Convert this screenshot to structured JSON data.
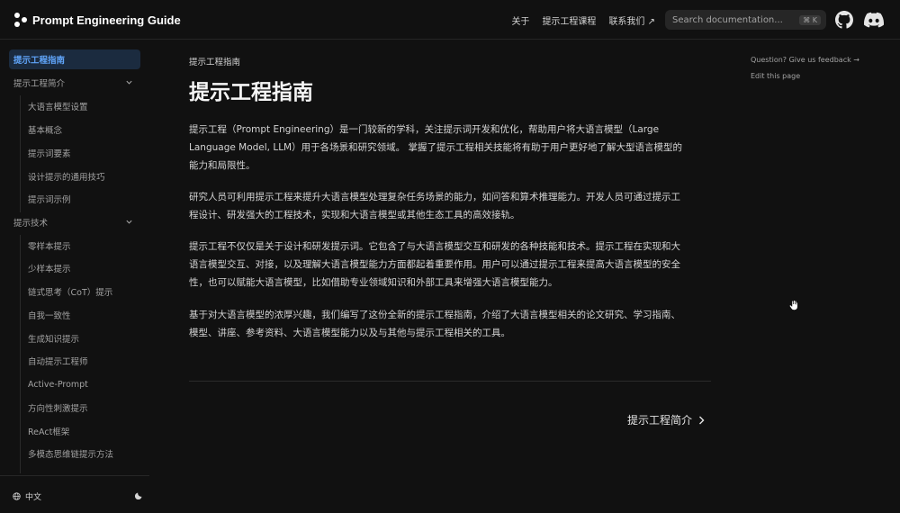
{
  "header": {
    "logo_text": "Prompt Engineering Guide",
    "nav": [
      {
        "label": "关于"
      },
      {
        "label": "提示工程课程"
      },
      {
        "label": "联系我们 ↗"
      }
    ],
    "search": {
      "placeholder": "Search documentation...",
      "shortcut": "⌘ K"
    },
    "icons": [
      "github-icon",
      "discord-icon"
    ]
  },
  "sidebar": {
    "items": [
      {
        "label": "提示工程指南",
        "active": true
      },
      {
        "label": "提示工程简介",
        "expandable": true
      },
      {
        "label": "大语言模型设置",
        "child": true
      },
      {
        "label": "基本概念",
        "child": true
      },
      {
        "label": "提示词要素",
        "child": true
      },
      {
        "label": "设计提示的通用技巧",
        "child": true
      },
      {
        "label": "提示词示例",
        "child": true
      },
      {
        "label": "提示技术",
        "expandable": true
      },
      {
        "label": "零样本提示",
        "child": true
      },
      {
        "label": "少样本提示",
        "child": true
      },
      {
        "label": "链式思考（CoT）提示",
        "child": true
      },
      {
        "label": "自我一致性",
        "child": true
      },
      {
        "label": "生成知识提示",
        "child": true
      },
      {
        "label": "自动提示工程师",
        "child": true
      },
      {
        "label": "Active-Prompt",
        "child": true
      },
      {
        "label": "方向性刺激提示",
        "child": true
      },
      {
        "label": "ReAct框架",
        "child": true
      },
      {
        "label": "多模态思维链提示方法",
        "child": true
      }
    ],
    "footer": {
      "language": "中文"
    }
  },
  "main": {
    "breadcrumb": "提示工程指南",
    "title": "提示工程指南",
    "paragraphs": [
      [
        "提示工程（Prompt Engineering）是一门较新的学科，关注提示词开发和优化，帮助用户将大语言模型（Large",
        "Language Model, LLM）用于各场景和研究领域。 掌握了提示工程相关技能将有助于用户更好地了解大型语言模型的",
        "能力和局限性。"
      ],
      [
        "研究人员可利用提示工程来提升大语言模型处理复杂任务场景的能力，如问答和算术推理能力。开发人员可通过提示工",
        "程设计、研发强大的工程技术，实现和大语言模型或其他生态工具的高效接轨。"
      ],
      [
        "提示工程不仅仅是关于设计和研发提示词。它包含了与大语言模型交互和研发的各种技能和技术。提示工程在实现和大",
        "语言模型交互、对接，以及理解大语言模型能力方面都起着重要作用。用户可以通过提示工程来提高大语言模型的安全",
        "性，也可以赋能大语言模型，比如借助专业领域知识和外部工具来增强大语言模型能力。"
      ],
      [
        "基于对大语言模型的浓厚兴趣，我们编写了这份全新的提示工程指南，介绍了大语言模型相关的论文研究、学习指南、",
        "模型、讲座、参考资料、大语言模型能力以及与其他与提示工程相关的工具。"
      ]
    ],
    "next_label": "提示工程简介"
  },
  "toc": {
    "feedback": "Question? Give us feedback →",
    "edit": "Edit this page"
  },
  "colors": {
    "background": "#111111",
    "accent": "#60a5fa",
    "active_bg": "#1b2b3f"
  }
}
